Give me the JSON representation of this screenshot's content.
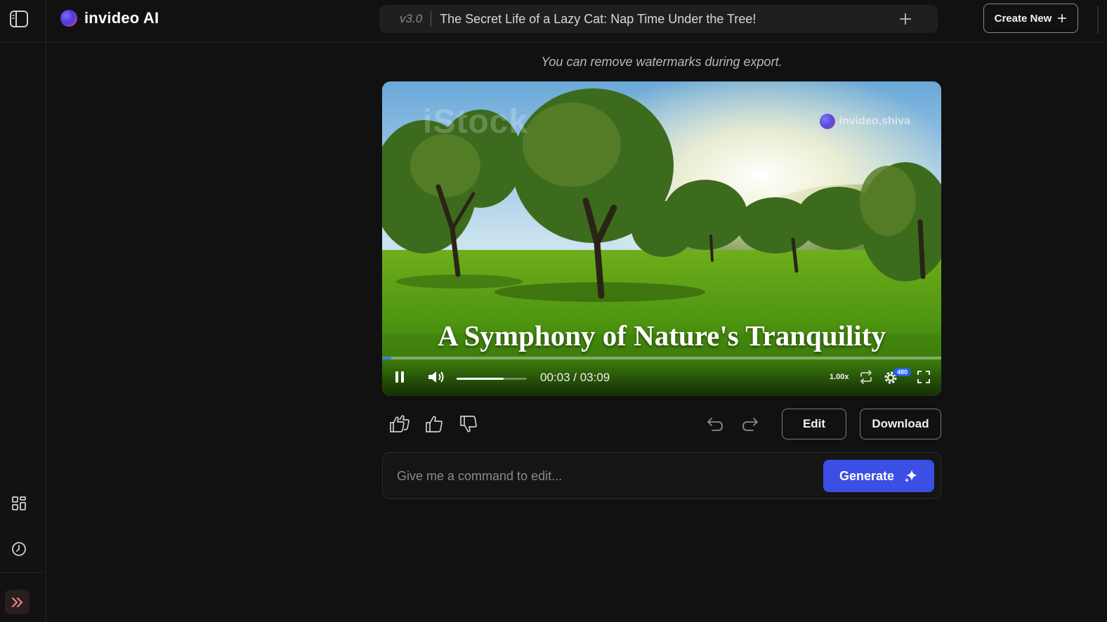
{
  "app": {
    "name": "invideo AI",
    "accent_color": "#3b4fe4"
  },
  "header": {
    "version": "v3.0",
    "project_title": "The Secret Life of a Lazy Cat: Nap Time Under the Tree!",
    "add_icon": "plus-icon",
    "create_new_label": "Create New"
  },
  "sidebar": {
    "toggle_icon": "sidebar-toggle-icon",
    "items": [
      {
        "icon": "grid-icon",
        "name": "dashboard"
      },
      {
        "icon": "clock-icon",
        "name": "history"
      }
    ],
    "expand_icon": "double-chevron-right-icon"
  },
  "main": {
    "watermark_note": "You can remove watermarks during export."
  },
  "player": {
    "watermark_stock": "iStock",
    "watermark_brand": "invideo.shiva",
    "caption": "A Symphony of Nature's Tranquility",
    "current_time": "00:03",
    "duration": "03:09",
    "time_display": "00:03 / 03:09",
    "progress_fraction": 0.016,
    "volume_fraction": 0.67,
    "speed": "1.00x",
    "quality": "480",
    "state": "playing"
  },
  "actions": {
    "feedback": [
      "love-it",
      "like",
      "dislike"
    ],
    "edit_label": "Edit",
    "download_label": "Download"
  },
  "command": {
    "placeholder": "Give me a command to edit...",
    "value": "",
    "generate_label": "Generate"
  }
}
